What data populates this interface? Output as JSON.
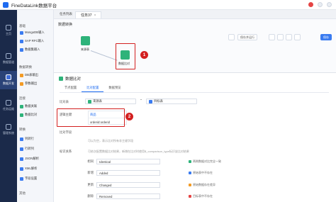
{
  "app": {
    "title": "FineDataLink数据平台"
  },
  "nav": [
    {
      "label": "主页"
    },
    {
      "label": "数据开发"
    },
    {
      "label": "数据管道"
    },
    {
      "label": "任务运维"
    },
    {
      "label": "管理系统"
    }
  ],
  "palette": {
    "head1": "基础",
    "items1": [
      "MongoDB输入",
      "SAP RFC输入",
      "数据集输入"
    ],
    "head2": "数据转换",
    "items2": [
      "DB表输出",
      "参数输出"
    ],
    "head3": "连接",
    "items3": [
      "数据关联",
      "数据比对"
    ],
    "head4": "转换",
    "items4": [
      "列转行",
      "行转列",
      "JSON解析",
      "XML解析",
      "字段设置"
    ],
    "head5": "其他"
  },
  "tabs": {
    "file_tab": "任务列表",
    "task_tab": "任务37"
  },
  "canvas": {
    "title": "数据转换",
    "toolbar": {
      "run": "保存并运行",
      "save": "保存"
    },
    "node_source_label": "来源表",
    "node_compare_label": "数据比对"
  },
  "panel": {
    "title": "数据比对",
    "tabs": [
      "节点配置",
      "比对配置",
      "数据预览"
    ],
    "active_tab": 1,
    "labels": {
      "compare_table": "比对表",
      "key_fields": "逻辑主键",
      "compare_fields": "比对字段",
      "status_id": "标识关系"
    },
    "source_field": "来源表",
    "target_field": "目标表",
    "key_rows": [
      "商品",
      "orderid:orderid"
    ],
    "hint_compare": "可以为空，表示比对所有非主键字段",
    "hint_status": "可依次配置数据比对结果，新增在比对时使用$_comparison_type标识该比对结果",
    "statuses": [
      {
        "name": "相同",
        "value": "Identical",
        "note": "两侧数据对比完全一致",
        "color": "#2eb37a"
      },
      {
        "name": "新增",
        "value": "Added",
        "note": "原始表中不存在",
        "color": "#3a7bf0"
      },
      {
        "name": "更新",
        "value": "Changed",
        "note": "原始数据存在差异",
        "color": "#f39b25"
      },
      {
        "name": "删除",
        "value": "Removed",
        "note": "目标表中不存在",
        "color": "#e54545"
      }
    ]
  },
  "callouts": [
    "1",
    "2"
  ]
}
